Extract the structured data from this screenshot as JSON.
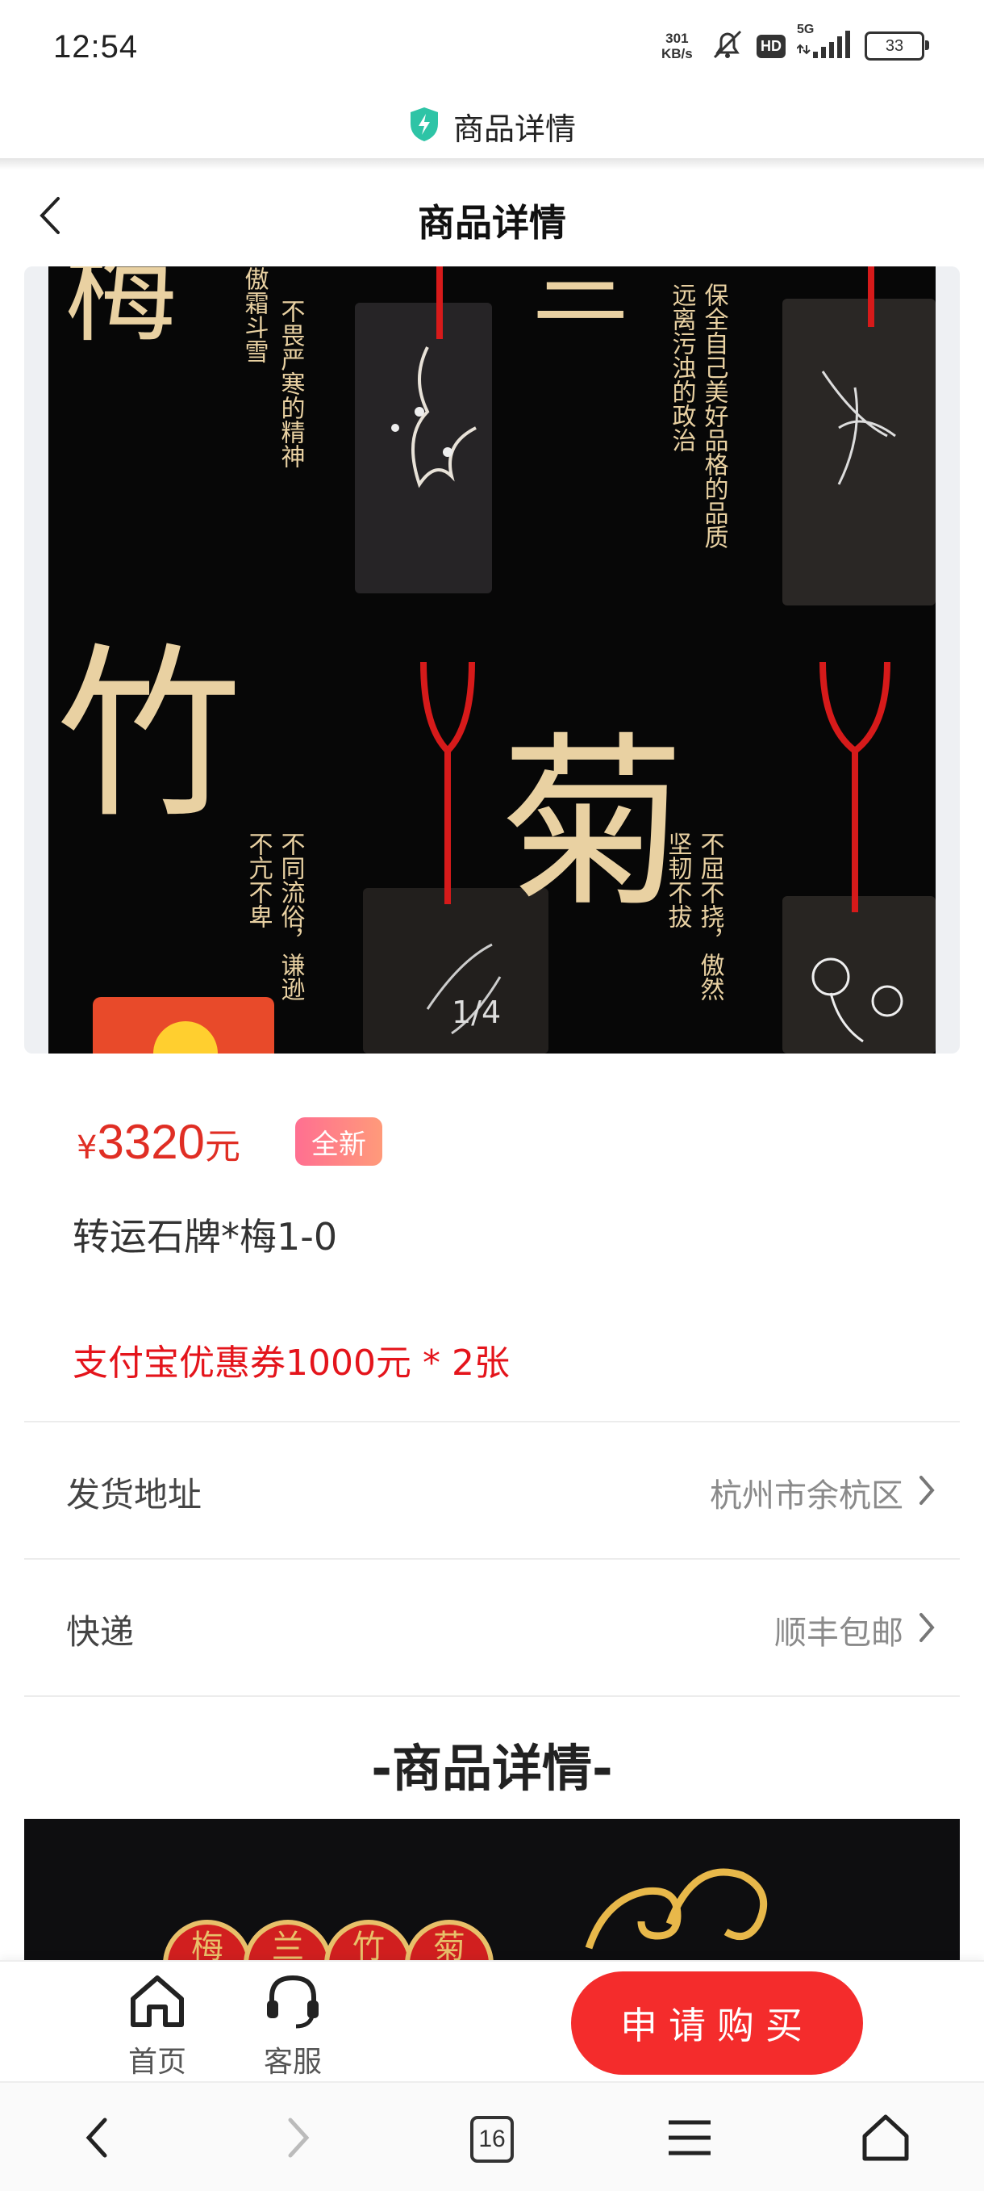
{
  "status_bar": {
    "time": "12:54",
    "net_speed_value": "301",
    "net_speed_unit": "KB/s",
    "battery": "33",
    "signal_label": "5G",
    "hd_label": "HD"
  },
  "browser": {
    "title": "商品详情"
  },
  "header": {
    "title": "商品详情"
  },
  "carousel": {
    "pager": "1/4",
    "image_description_words": {
      "big_chars": [
        "竹",
        "菊"
      ],
      "poem_left_top": "不畏严寒的精神 傲霜斗雪",
      "poem_right_top": "远离污浊的政治 保全自己美好品格的品质",
      "poem_left_bottom": "不亢不卑 不同流俗，谦逊",
      "poem_right_bottom": "坚韧不拔 不屈不挠，傲然"
    }
  },
  "product": {
    "price_symbol": "¥",
    "price": "3320",
    "price_unit": "元",
    "condition_badge": "全新",
    "name": "转运石牌*梅1-0",
    "coupon": "支付宝优惠券1000元 * 2张"
  },
  "rows": [
    {
      "label": "发货地址",
      "value": "杭州市余杭区"
    },
    {
      "label": "快递",
      "value": "顺丰包邮"
    }
  ],
  "detail_section": {
    "title": "-商品详情-",
    "chips": [
      "梅",
      "兰",
      "竹",
      "菊"
    ]
  },
  "action_bar": {
    "home": "首页",
    "service": "客服",
    "buy": "申请购买"
  },
  "sys_nav": {
    "tabs_count": "16"
  },
  "colors": {
    "accent": "#e02e24",
    "buy_button": "#f42c2c",
    "coupon": "#e4141b",
    "badge_gradient_start": "#ff6f91",
    "badge_gradient_end": "#ff9a7a"
  }
}
